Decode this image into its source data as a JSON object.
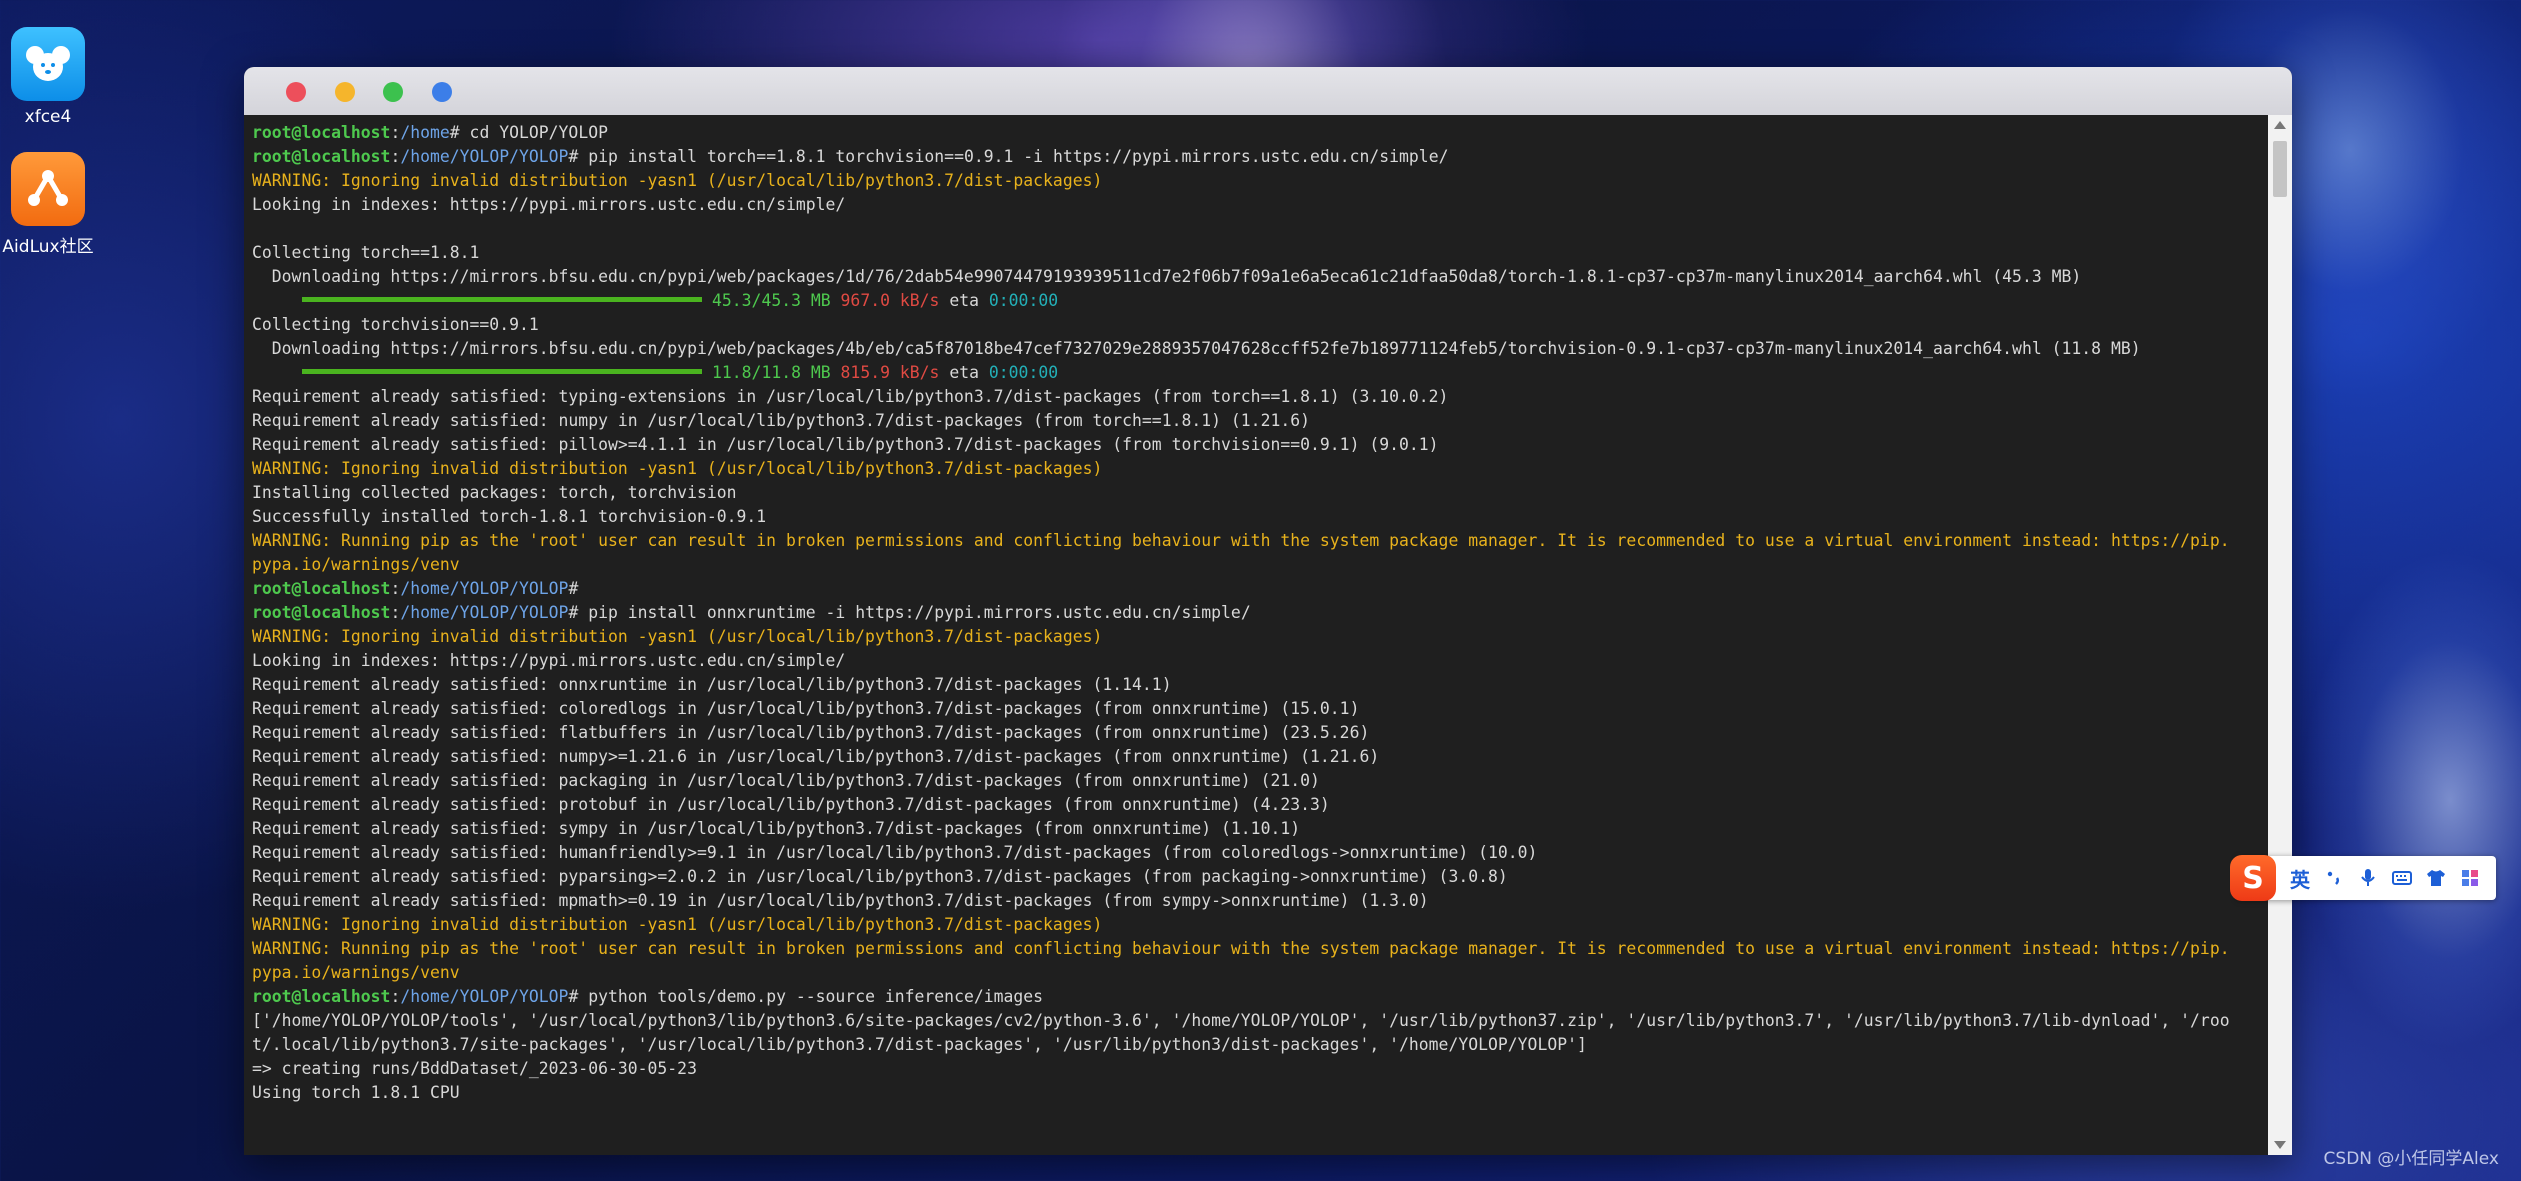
{
  "desktop": {
    "icons": [
      {
        "label": "xfce4",
        "icon": "mouse-head-icon"
      },
      {
        "label": "AidLux社区",
        "icon": "aidlux-logo-icon"
      }
    ]
  },
  "terminal": {
    "window_buttons": [
      "close",
      "minimize",
      "maximize",
      "extra"
    ],
    "lines": [
      [
        {
          "t": "root@localhost",
          "c": "c-user"
        },
        {
          "t": ":"
        },
        {
          "t": "/home",
          "c": "c-path"
        },
        {
          "t": "# cd YOLOP/YOLOP"
        }
      ],
      [
        {
          "t": "root@localhost",
          "c": "c-user"
        },
        {
          "t": ":"
        },
        {
          "t": "/home/YOLOP/YOLOP",
          "c": "c-path"
        },
        {
          "t": "# pip install torch==1.8.1 torchvision==0.9.1 -i https://pypi.mirrors.ustc.edu.cn/simple/"
        }
      ],
      [
        {
          "t": "WARNING: Ignoring invalid distribution -yasn1 (/usr/local/lib/python3.7/dist-packages)",
          "c": "c-warn"
        }
      ],
      [
        {
          "t": "Looking in indexes: https://pypi.mirrors.ustc.edu.cn/simple/"
        }
      ],
      [
        {
          "t": ""
        }
      ],
      [
        {
          "t": "Collecting torch==1.8.1"
        }
      ],
      [
        {
          "t": "  Downloading https://mirrors.bfsu.edu.cn/pypi/web/packages/1d/76/2dab54e99074479193939511cd7e2f06b7f09a1e6a5eca61c21dfaa50da8/torch-1.8.1-cp37-cp37m-manylinux2014_aarch64.whl (45.3 MB)"
        }
      ],
      [
        {
          "bar": true
        },
        {
          "t": "45.3/45.3 MB",
          "c": "c-bar-text"
        },
        {
          "t": " "
        },
        {
          "t": "967.0 kB/s",
          "c": "c-speed"
        },
        {
          "t": " eta "
        },
        {
          "t": "0:00:00",
          "c": "c-eta"
        }
      ],
      [
        {
          "t": "Collecting torchvision==0.9.1"
        }
      ],
      [
        {
          "t": "  Downloading https://mirrors.bfsu.edu.cn/pypi/web/packages/4b/eb/ca5f87018be47cef7327029e2889357047628ccff52fe7b189771124feb5/torchvision-0.9.1-cp37-cp37m-manylinux2014_aarch64.whl (11.8 MB)"
        }
      ],
      [
        {
          "bar": true
        },
        {
          "t": "11.8/11.8 MB",
          "c": "c-bar-text"
        },
        {
          "t": " "
        },
        {
          "t": "815.9 kB/s",
          "c": "c-speed"
        },
        {
          "t": " eta "
        },
        {
          "t": "0:00:00",
          "c": "c-eta"
        }
      ],
      [
        {
          "t": "Requirement already satisfied: typing-extensions in /usr/local/lib/python3.7/dist-packages (from torch==1.8.1) (3.10.0.2)"
        }
      ],
      [
        {
          "t": "Requirement already satisfied: numpy in /usr/local/lib/python3.7/dist-packages (from torch==1.8.1) (1.21.6)"
        }
      ],
      [
        {
          "t": "Requirement already satisfied: pillow>=4.1.1 in /usr/local/lib/python3.7/dist-packages (from torchvision==0.9.1) (9.0.1)"
        }
      ],
      [
        {
          "t": "WARNING: Ignoring invalid distribution -yasn1 (/usr/local/lib/python3.7/dist-packages)",
          "c": "c-warn"
        }
      ],
      [
        {
          "t": "Installing collected packages: torch, torchvision"
        }
      ],
      [
        {
          "t": "Successfully installed torch-1.8.1 torchvision-0.9.1"
        }
      ],
      [
        {
          "t": "WARNING: Running pip as the 'root' user can result in broken permissions and conflicting behaviour with the system package manager. It is recommended to use a virtual environment instead: https://pip.",
          "c": "c-warn"
        }
      ],
      [
        {
          "t": "pypa.io/warnings/venv",
          "c": "c-warn"
        }
      ],
      [
        {
          "t": "root@localhost",
          "c": "c-user"
        },
        {
          "t": ":"
        },
        {
          "t": "/home/YOLOP/YOLOP",
          "c": "c-path"
        },
        {
          "t": "#"
        }
      ],
      [
        {
          "t": "root@localhost",
          "c": "c-user"
        },
        {
          "t": ":"
        },
        {
          "t": "/home/YOLOP/YOLOP",
          "c": "c-path"
        },
        {
          "t": "# pip install onnxruntime -i https://pypi.mirrors.ustc.edu.cn/simple/"
        }
      ],
      [
        {
          "t": "WARNING: Ignoring invalid distribution -yasn1 (/usr/local/lib/python3.7/dist-packages)",
          "c": "c-warn"
        }
      ],
      [
        {
          "t": "Looking in indexes: https://pypi.mirrors.ustc.edu.cn/simple/"
        }
      ],
      [
        {
          "t": "Requirement already satisfied: onnxruntime in /usr/local/lib/python3.7/dist-packages (1.14.1)"
        }
      ],
      [
        {
          "t": "Requirement already satisfied: coloredlogs in /usr/local/lib/python3.7/dist-packages (from onnxruntime) (15.0.1)"
        }
      ],
      [
        {
          "t": "Requirement already satisfied: flatbuffers in /usr/local/lib/python3.7/dist-packages (from onnxruntime) (23.5.26)"
        }
      ],
      [
        {
          "t": "Requirement already satisfied: numpy>=1.21.6 in /usr/local/lib/python3.7/dist-packages (from onnxruntime) (1.21.6)"
        }
      ],
      [
        {
          "t": "Requirement already satisfied: packaging in /usr/local/lib/python3.7/dist-packages (from onnxruntime) (21.0)"
        }
      ],
      [
        {
          "t": "Requirement already satisfied: protobuf in /usr/local/lib/python3.7/dist-packages (from onnxruntime) (4.23.3)"
        }
      ],
      [
        {
          "t": "Requirement already satisfied: sympy in /usr/local/lib/python3.7/dist-packages (from onnxruntime) (1.10.1)"
        }
      ],
      [
        {
          "t": "Requirement already satisfied: humanfriendly>=9.1 in /usr/local/lib/python3.7/dist-packages (from coloredlogs->onnxruntime) (10.0)"
        }
      ],
      [
        {
          "t": "Requirement already satisfied: pyparsing>=2.0.2 in /usr/local/lib/python3.7/dist-packages (from packaging->onnxruntime) (3.0.8)"
        }
      ],
      [
        {
          "t": "Requirement already satisfied: mpmath>=0.19 in /usr/local/lib/python3.7/dist-packages (from sympy->onnxruntime) (1.3.0)"
        }
      ],
      [
        {
          "t": "WARNING: Ignoring invalid distribution -yasn1 (/usr/local/lib/python3.7/dist-packages)",
          "c": "c-warn"
        }
      ],
      [
        {
          "t": "WARNING: Running pip as the 'root' user can result in broken permissions and conflicting behaviour with the system package manager. It is recommended to use a virtual environment instead: https://pip.",
          "c": "c-warn"
        }
      ],
      [
        {
          "t": "pypa.io/warnings/venv",
          "c": "c-warn"
        }
      ],
      [
        {
          "t": "root@localhost",
          "c": "c-user"
        },
        {
          "t": ":"
        },
        {
          "t": "/home/YOLOP/YOLOP",
          "c": "c-path"
        },
        {
          "t": "# python tools/demo.py --source inference/images"
        }
      ],
      [
        {
          "t": "['/home/YOLOP/YOLOP/tools', '/usr/local/python3/lib/python3.6/site-packages/cv2/python-3.6', '/home/YOLOP/YOLOP', '/usr/lib/python37.zip', '/usr/lib/python3.7', '/usr/lib/python3.7/lib-dynload', '/roo"
        }
      ],
      [
        {
          "t": "t/.local/lib/python3.7/site-packages', '/usr/local/lib/python3.7/dist-packages', '/usr/lib/python3/dist-packages', '/home/YOLOP/YOLOP']"
        }
      ],
      [
        {
          "t": "=> creating runs/BddDataset/_2023-06-30-05-23"
        }
      ],
      [
        {
          "t": "Using torch 1.8.1 CPU"
        }
      ]
    ]
  },
  "ime": {
    "logo": "S",
    "mode": "英",
    "icons": [
      "punctuation-icon",
      "microphone-icon",
      "keyboard-icon",
      "skin-icon",
      "toolbox-icon"
    ]
  },
  "watermark": "CSDN @小任同学Alex",
  "colors": {
    "user": "#4ec94e",
    "path": "#6ea4e8",
    "warning": "#e8b21c",
    "speed": "#e04a43",
    "eta": "#23b0b8",
    "progress": "#4ab31f"
  }
}
